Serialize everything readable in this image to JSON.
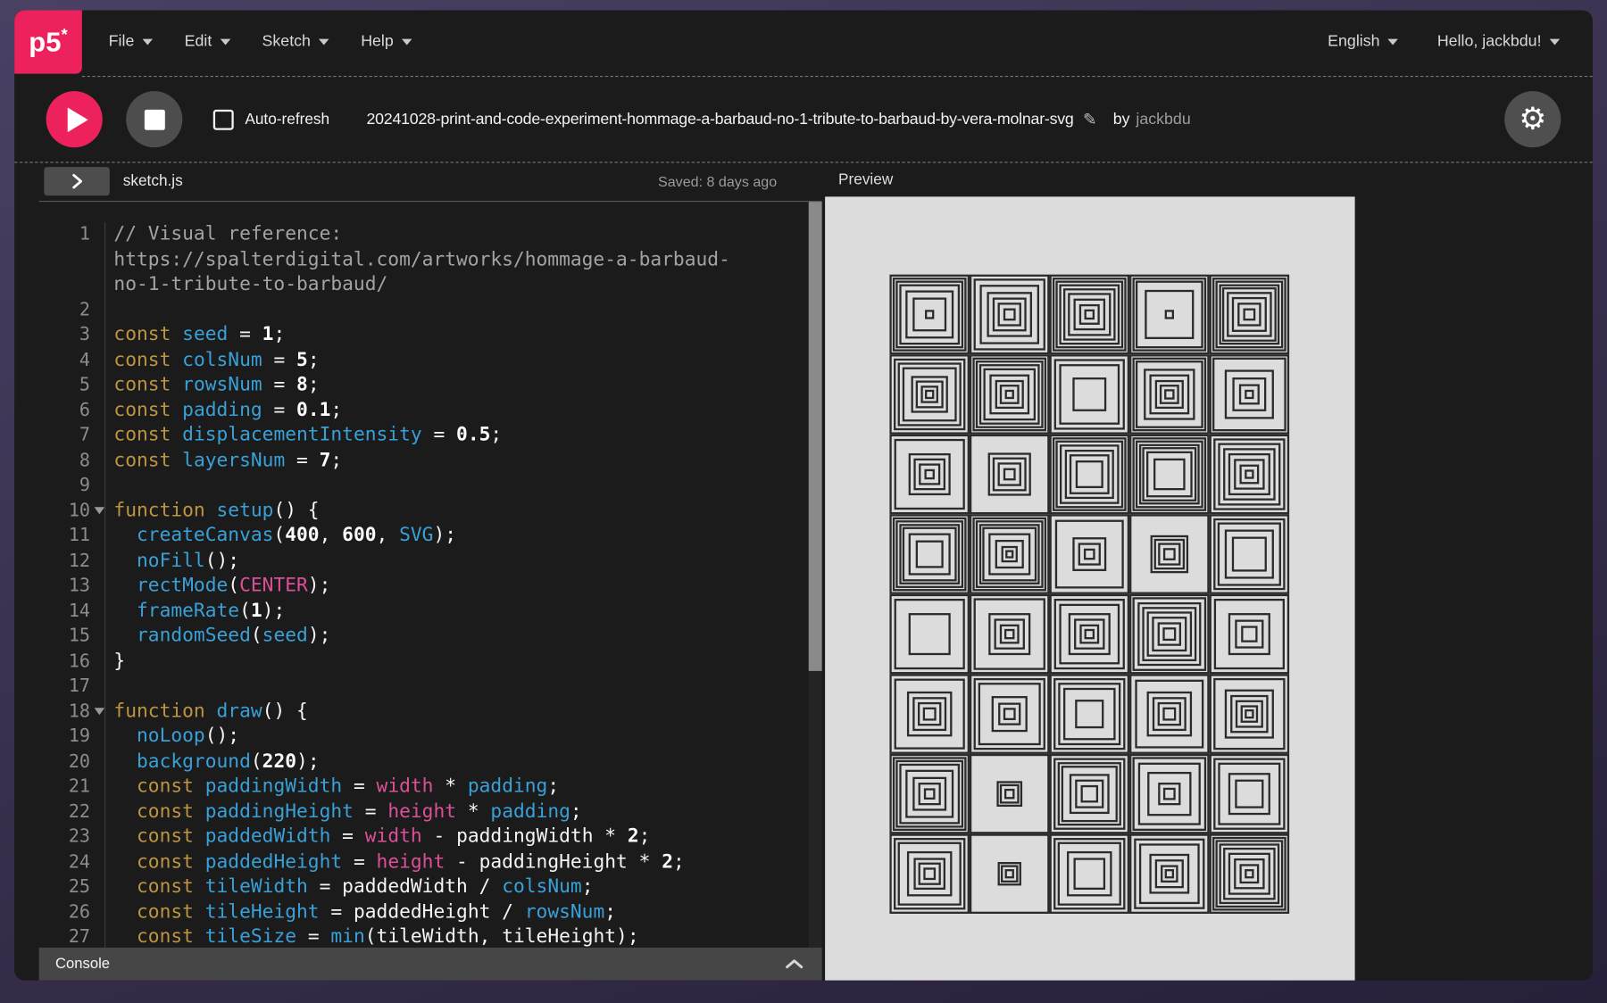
{
  "nav": {
    "logo": "p5",
    "logo_unsaved_marker": "*",
    "menus": [
      {
        "label": "File"
      },
      {
        "label": "Edit"
      },
      {
        "label": "Sketch"
      },
      {
        "label": "Help"
      }
    ],
    "language": {
      "label": "English"
    },
    "user": {
      "greeting": "Hello, jackbdu!"
    }
  },
  "toolbar": {
    "auto_refresh_label": "Auto-refresh",
    "sketch_title": "20241028-print-and-code-experiment-hommage-a-barbaud-no-1-tribute-to-barbaud-by-vera-molnar-svg",
    "by_label": "by",
    "author": "jackbdu",
    "icons": {
      "play": "play-icon",
      "stop": "stop-icon",
      "edit_name": "pencil-icon",
      "settings": "gear-icon"
    }
  },
  "editor": {
    "filename": "sketch.js",
    "saved_status": "Saved: 8 days ago",
    "code": {
      "lines": [
        {
          "n": 1,
          "tokens": [
            [
              "c",
              "// Visual reference:\nhttps://spalterdigital.com/artworks/hommage-a-barbaud-\nno-1-tribute-to-barbaud/"
            ]
          ]
        },
        {
          "n": 2,
          "tokens": []
        },
        {
          "n": 3,
          "tokens": [
            [
              "k",
              "const"
            ],
            [
              "p",
              " "
            ],
            [
              "d",
              "seed"
            ],
            [
              "p",
              " = "
            ],
            [
              "n",
              "1"
            ],
            [
              "p",
              ";"
            ]
          ]
        },
        {
          "n": 4,
          "tokens": [
            [
              "k",
              "const"
            ],
            [
              "p",
              " "
            ],
            [
              "d",
              "colsNum"
            ],
            [
              "p",
              " = "
            ],
            [
              "n",
              "5"
            ],
            [
              "p",
              ";"
            ]
          ]
        },
        {
          "n": 5,
          "tokens": [
            [
              "k",
              "const"
            ],
            [
              "p",
              " "
            ],
            [
              "d",
              "rowsNum"
            ],
            [
              "p",
              " = "
            ],
            [
              "n",
              "8"
            ],
            [
              "p",
              ";"
            ]
          ]
        },
        {
          "n": 6,
          "tokens": [
            [
              "k",
              "const"
            ],
            [
              "p",
              " "
            ],
            [
              "d",
              "padding"
            ],
            [
              "p",
              " = "
            ],
            [
              "n",
              "0.1"
            ],
            [
              "p",
              ";"
            ]
          ]
        },
        {
          "n": 7,
          "tokens": [
            [
              "k",
              "const"
            ],
            [
              "p",
              " "
            ],
            [
              "d",
              "displacementIntensity"
            ],
            [
              "p",
              " = "
            ],
            [
              "n",
              "0.5"
            ],
            [
              "p",
              ";"
            ]
          ]
        },
        {
          "n": 8,
          "tokens": [
            [
              "k",
              "const"
            ],
            [
              "p",
              " "
            ],
            [
              "d",
              "layersNum"
            ],
            [
              "p",
              " = "
            ],
            [
              "n",
              "7"
            ],
            [
              "p",
              ";"
            ]
          ]
        },
        {
          "n": 9,
          "tokens": []
        },
        {
          "n": 10,
          "fold": true,
          "tokens": [
            [
              "k",
              "function"
            ],
            [
              "p",
              " "
            ],
            [
              "d",
              "setup"
            ],
            [
              "p",
              "() {"
            ]
          ]
        },
        {
          "n": 11,
          "tokens": [
            [
              "p",
              "  "
            ],
            [
              "d",
              "createCanvas"
            ],
            [
              "p",
              "("
            ],
            [
              "n",
              "400"
            ],
            [
              "p",
              ", "
            ],
            [
              "n",
              "600"
            ],
            [
              "p",
              ", "
            ],
            [
              "d",
              "SVG"
            ],
            [
              "p",
              ");"
            ]
          ]
        },
        {
          "n": 12,
          "tokens": [
            [
              "p",
              "  "
            ],
            [
              "d",
              "noFill"
            ],
            [
              "p",
              "();"
            ]
          ]
        },
        {
          "n": 13,
          "tokens": [
            [
              "p",
              "  "
            ],
            [
              "d",
              "rectMode"
            ],
            [
              "p",
              "("
            ],
            [
              "a",
              "CENTER"
            ],
            [
              "p",
              ");"
            ]
          ]
        },
        {
          "n": 14,
          "tokens": [
            [
              "p",
              "  "
            ],
            [
              "d",
              "frameRate"
            ],
            [
              "p",
              "("
            ],
            [
              "n",
              "1"
            ],
            [
              "p",
              ");"
            ]
          ]
        },
        {
          "n": 15,
          "tokens": [
            [
              "p",
              "  "
            ],
            [
              "d",
              "randomSeed"
            ],
            [
              "p",
              "("
            ],
            [
              "d",
              "seed"
            ],
            [
              "p",
              ");"
            ]
          ]
        },
        {
          "n": 16,
          "tokens": [
            [
              "p",
              "}"
            ]
          ]
        },
        {
          "n": 17,
          "tokens": []
        },
        {
          "n": 18,
          "fold": true,
          "tokens": [
            [
              "k",
              "function"
            ],
            [
              "p",
              " "
            ],
            [
              "d",
              "draw"
            ],
            [
              "p",
              "() {"
            ]
          ]
        },
        {
          "n": 19,
          "tokens": [
            [
              "p",
              "  "
            ],
            [
              "d",
              "noLoop"
            ],
            [
              "p",
              "();"
            ]
          ]
        },
        {
          "n": 20,
          "tokens": [
            [
              "p",
              "  "
            ],
            [
              "d",
              "background"
            ],
            [
              "p",
              "("
            ],
            [
              "n",
              "220"
            ],
            [
              "p",
              ");"
            ]
          ]
        },
        {
          "n": 21,
          "tokens": [
            [
              "p",
              "  "
            ],
            [
              "k",
              "const"
            ],
            [
              "p",
              " "
            ],
            [
              "d",
              "paddingWidth"
            ],
            [
              "p",
              " = "
            ],
            [
              "a",
              "width"
            ],
            [
              "p",
              " * "
            ],
            [
              "d",
              "padding"
            ],
            [
              "p",
              ";"
            ]
          ]
        },
        {
          "n": 22,
          "tokens": [
            [
              "p",
              "  "
            ],
            [
              "k",
              "const"
            ],
            [
              "p",
              " "
            ],
            [
              "d",
              "paddingHeight"
            ],
            [
              "p",
              " = "
            ],
            [
              "a",
              "height"
            ],
            [
              "p",
              " * "
            ],
            [
              "d",
              "padding"
            ],
            [
              "p",
              ";"
            ]
          ]
        },
        {
          "n": 23,
          "tokens": [
            [
              "p",
              "  "
            ],
            [
              "k",
              "const"
            ],
            [
              "p",
              " "
            ],
            [
              "d",
              "paddedWidth"
            ],
            [
              "p",
              " = "
            ],
            [
              "a",
              "width"
            ],
            [
              "p",
              " - paddingWidth * "
            ],
            [
              "n",
              "2"
            ],
            [
              "p",
              ";"
            ]
          ]
        },
        {
          "n": 24,
          "tokens": [
            [
              "p",
              "  "
            ],
            [
              "k",
              "const"
            ],
            [
              "p",
              " "
            ],
            [
              "d",
              "paddedHeight"
            ],
            [
              "p",
              " = "
            ],
            [
              "a",
              "height"
            ],
            [
              "p",
              " - paddingHeight * "
            ],
            [
              "n",
              "2"
            ],
            [
              "p",
              ";"
            ]
          ]
        },
        {
          "n": 25,
          "tokens": [
            [
              "p",
              "  "
            ],
            [
              "k",
              "const"
            ],
            [
              "p",
              " "
            ],
            [
              "d",
              "tileWidth"
            ],
            [
              "p",
              " = paddedWidth / "
            ],
            [
              "d",
              "colsNum"
            ],
            [
              "p",
              ";"
            ]
          ]
        },
        {
          "n": 26,
          "tokens": [
            [
              "p",
              "  "
            ],
            [
              "k",
              "const"
            ],
            [
              "p",
              " "
            ],
            [
              "d",
              "tileHeight"
            ],
            [
              "p",
              " = paddedHeight / "
            ],
            [
              "d",
              "rowsNum"
            ],
            [
              "p",
              ";"
            ]
          ]
        },
        {
          "n": 27,
          "tokens": [
            [
              "p",
              "  "
            ],
            [
              "k",
              "const"
            ],
            [
              "p",
              " "
            ],
            [
              "d",
              "tileSize"
            ],
            [
              "p",
              " = "
            ],
            [
              "d",
              "min"
            ],
            [
              "p",
              "(tileWidth, tileHeight);"
            ]
          ]
        }
      ]
    }
  },
  "console": {
    "label": "Console"
  },
  "preview": {
    "label": "Preview",
    "canvas": {
      "background": "#dcdcdc",
      "stroke": "#2b2b2b",
      "cols": 5,
      "rows": 8,
      "tile_ring_sizes": [
        [
          1,
          0.92,
          0.84,
          0.76,
          0.6,
          0.42,
          0.12
        ],
        [
          1,
          0.9,
          0.74,
          0.56,
          0.42,
          0.3,
          0.16
        ],
        [
          1,
          0.92,
          0.84,
          0.76,
          0.66,
          0.54,
          0.4,
          0.26,
          0.13
        ],
        [
          1,
          0.92,
          0.84,
          0.62,
          0.12
        ],
        [
          1,
          0.92,
          0.84,
          0.76,
          0.68,
          0.56,
          0.44,
          0.3,
          0.15
        ],
        [
          1,
          0.9,
          0.8,
          0.68,
          0.46,
          0.34,
          0.22,
          0.12
        ],
        [
          1,
          0.92,
          0.84,
          0.76,
          0.66,
          0.5,
          0.36,
          0.24,
          0.12
        ],
        [
          1,
          0.88,
          0.76,
          0.42
        ],
        [
          1,
          0.92,
          0.84,
          0.64,
          0.5,
          0.36,
          0.24,
          0.13
        ],
        [
          1,
          0.92,
          0.62,
          0.42,
          0.26,
          0.12
        ],
        [
          1,
          0.88,
          0.52,
          0.4,
          0.27,
          0.13
        ],
        [
          1,
          0.54,
          0.42,
          0.3,
          0.16
        ],
        [
          1,
          0.92,
          0.84,
          0.74,
          0.62,
          0.5,
          0.34
        ],
        [
          1,
          0.92,
          0.84,
          0.76,
          0.68,
          0.58,
          0.4
        ],
        [
          1,
          0.9,
          0.78,
          0.66,
          0.52,
          0.38,
          0.24,
          0.12
        ],
        [
          1,
          0.92,
          0.84,
          0.76,
          0.68,
          0.52,
          0.34
        ],
        [
          1,
          0.92,
          0.84,
          0.76,
          0.68,
          0.52,
          0.36,
          0.2,
          0.1
        ],
        [
          1,
          0.86,
          0.42,
          0.28,
          0.14
        ],
        [
          1,
          0.48,
          0.38,
          0.28,
          0.16
        ],
        [
          1,
          0.9,
          0.8,
          0.62,
          0.44
        ],
        [
          1,
          0.88,
          0.52
        ],
        [
          1,
          0.9,
          0.52,
          0.38,
          0.24,
          0.13
        ],
        [
          1,
          0.88,
          0.76,
          0.52,
          0.38,
          0.24,
          0.13
        ],
        [
          1,
          0.92,
          0.8,
          0.68,
          0.56,
          0.44,
          0.3,
          0.17
        ],
        [
          1,
          0.88,
          0.52,
          0.36,
          0.2
        ],
        [
          1,
          0.88,
          0.56,
          0.42,
          0.3,
          0.17
        ],
        [
          1,
          0.9,
          0.78,
          0.45,
          0.28,
          0.15
        ],
        [
          1,
          0.9,
          0.78,
          0.66,
          0.36
        ],
        [
          1,
          0.86,
          0.56,
          0.42,
          0.3,
          0.17
        ],
        [
          1,
          0.9,
          0.62,
          0.48,
          0.35,
          0.22,
          0.12
        ],
        [
          1,
          0.92,
          0.84,
          0.76,
          0.6,
          0.42,
          0.28,
          0.14
        ],
        [
          1,
          0.32,
          0.24,
          0.13
        ],
        [
          1,
          0.9,
          0.8,
          0.7,
          0.5,
          0.36,
          0.22
        ],
        [
          1,
          0.92,
          0.78,
          0.55,
          0.28,
          0.16
        ],
        [
          1,
          0.9,
          0.78,
          0.52,
          0.36
        ],
        [
          1,
          0.9,
          0.8,
          0.56,
          0.4,
          0.28,
          0.15
        ],
        [
          1,
          0.3,
          0.22,
          0.12
        ],
        [
          1,
          0.9,
          0.8,
          0.56,
          0.4
        ],
        [
          1,
          0.88,
          0.76,
          0.5,
          0.36,
          0.22,
          0.12
        ],
        [
          1,
          0.92,
          0.84,
          0.76,
          0.66,
          0.52,
          0.38,
          0.24,
          0.12
        ]
      ]
    }
  },
  "colors": {
    "accent": "#ed225d",
    "app_background": "#1b1b1b",
    "frame": "#3a3150",
    "canvas_background": "#dcdcdc",
    "code_keyword": "#bd9440",
    "code_identifier": "#39a0d8",
    "code_special": "#dd4f99",
    "code_plain": "#f5f5f5",
    "code_comment": "#a3a3a3"
  }
}
